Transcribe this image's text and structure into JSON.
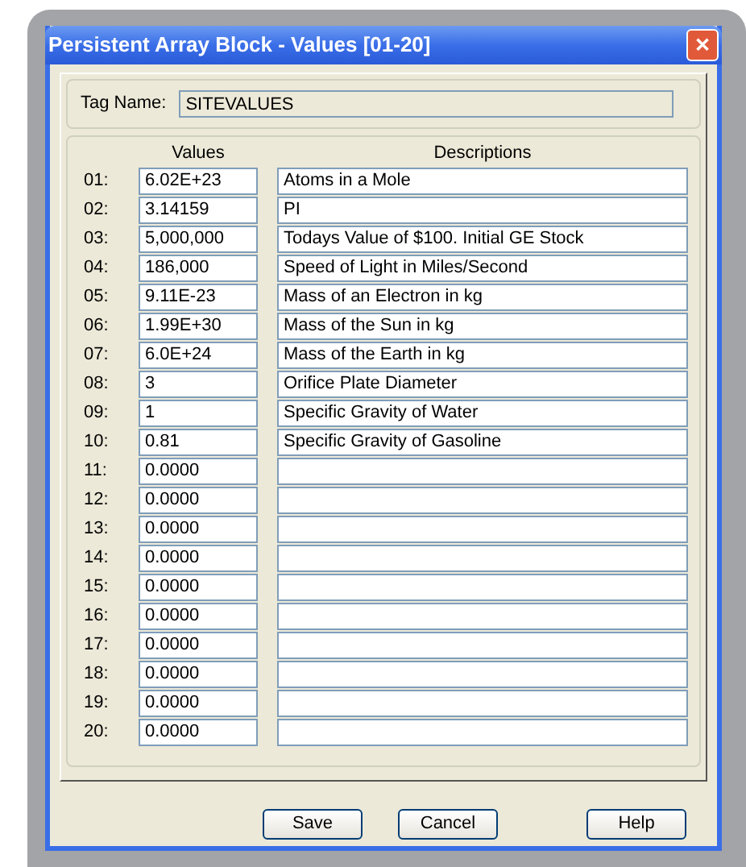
{
  "window": {
    "title": "Persistent Array Block - Values [01-20]",
    "close": "✕"
  },
  "tag": {
    "label": "Tag Name:",
    "value": "SITEVALUES"
  },
  "columns": {
    "values": "Values",
    "descriptions": "Descriptions"
  },
  "rows": [
    {
      "index": "01:",
      "value": "6.02E+23",
      "description": "Atoms in a Mole"
    },
    {
      "index": "02:",
      "value": "3.14159",
      "description": "PI"
    },
    {
      "index": "03:",
      "value": "5,000,000",
      "description": "Todays Value of $100. Initial GE Stock"
    },
    {
      "index": "04:",
      "value": "186,000",
      "description": "Speed of Light in Miles/Second"
    },
    {
      "index": "05:",
      "value": "9.11E-23",
      "description": "Mass of an Electron in kg"
    },
    {
      "index": "06:",
      "value": "1.99E+30",
      "description": "Mass of the Sun in kg"
    },
    {
      "index": "07:",
      "value": "6.0E+24",
      "description": "Mass of the Earth in kg"
    },
    {
      "index": "08:",
      "value": "3",
      "description": "Orifice Plate Diameter"
    },
    {
      "index": "09:",
      "value": "1",
      "description": "Specific Gravity of Water"
    },
    {
      "index": "10:",
      "value": "0.81",
      "description": "Specific Gravity of Gasoline"
    },
    {
      "index": "11:",
      "value": "0.0000"
    },
    {
      "index": "12:",
      "value": "0.0000"
    },
    {
      "index": "13:",
      "value": "0.0000"
    },
    {
      "index": "14:",
      "value": "0.0000"
    },
    {
      "index": "15:",
      "value": "0.0000"
    },
    {
      "index": "16:",
      "value": "0.0000"
    },
    {
      "index": "17:",
      "value": "0.0000"
    },
    {
      "index": "18:",
      "value": "0.0000"
    },
    {
      "index": "19:",
      "value": "0.0000"
    },
    {
      "index": "20:",
      "value": "0.0000"
    }
  ],
  "buttons": [
    "Save",
    "Cancel",
    "Help"
  ]
}
